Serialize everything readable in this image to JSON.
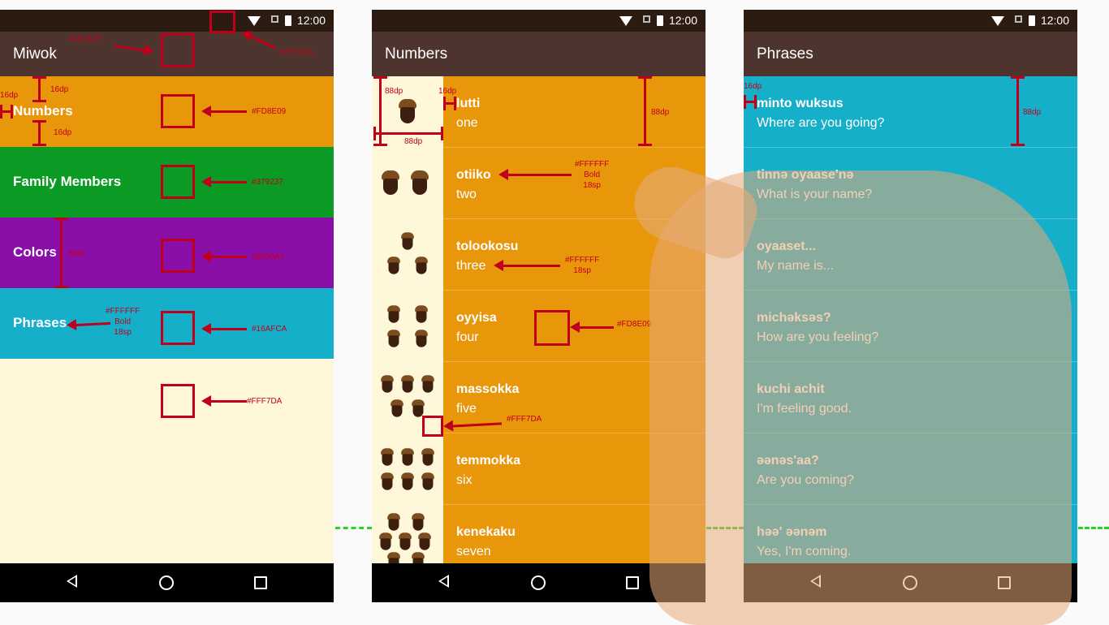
{
  "status_time": "12:00",
  "phone1": {
    "title": "Miwok",
    "categories": [
      {
        "label": "Numbers",
        "color": "#FD8E09"
      },
      {
        "label": "Family Members",
        "color": "#379237"
      },
      {
        "label": "Colors",
        "color": "#8800A0"
      },
      {
        "label": "Phrases",
        "color": "#16AFCA"
      }
    ],
    "background": "#FFF7DA",
    "annotations": {
      "appbar_color": "#4E342E",
      "statusbar_color": "#2F1D1A",
      "numbers_color": "#FD8E09",
      "family_color": "#379237",
      "colors_color": "#8800A0",
      "phrases_color": "#16AFCA",
      "bg_color": "#FFF7DA",
      "dp16_a": "16dp",
      "dp16_b": "16dp",
      "dp16_c": "16dp",
      "dp88": "88dp",
      "text_style": [
        "#FFFFFF",
        "Bold",
        "18sp"
      ]
    }
  },
  "phone2": {
    "title": "Numbers",
    "row_color": "#FD8E09",
    "image_bg": "#FFF7DA",
    "rows": [
      {
        "miwok": "lutti",
        "english": "one",
        "acorns": 1
      },
      {
        "miwok": "otiiko",
        "english": "two",
        "acorns": 2
      },
      {
        "miwok": "tolookosu",
        "english": "three",
        "acorns": 3
      },
      {
        "miwok": "oyyisa",
        "english": "four",
        "acorns": 4
      },
      {
        "miwok": "massokka",
        "english": "five",
        "acorns": 5
      },
      {
        "miwok": "temmokka",
        "english": "six",
        "acorns": 6
      },
      {
        "miwok": "kenekaku",
        "english": "seven",
        "acorns": 7
      }
    ],
    "annotations": {
      "dp88_img_h": "88dp",
      "dp88_img_w": "88dp",
      "dp16": "16dp",
      "dp88_row": "88dp",
      "miwok_style": [
        "#FFFFFF",
        "Bold",
        "18sp"
      ],
      "english_style": [
        "#FFFFFF",
        "18sp"
      ],
      "row_color": "#FD8E09",
      "img_color": "#FFF7DA"
    }
  },
  "phone3": {
    "title": "Phrases",
    "row_color": "#16AFCA",
    "rows": [
      {
        "miwok": "minto wuksus",
        "english": "Where are you going?"
      },
      {
        "miwok": "tinnә oyaase'nә",
        "english": "What is your name?"
      },
      {
        "miwok": "oyaaset...",
        "english": "My name is..."
      },
      {
        "miwok": "michәksәs?",
        "english": "How are you feeling?"
      },
      {
        "miwok": "kuchi achit",
        "english": "I'm feeling good."
      },
      {
        "miwok": "әәnәs'aa?",
        "english": "Are you coming?"
      },
      {
        "miwok": "hәә' әәnәm",
        "english": "Yes, I'm coming."
      }
    ],
    "annotations": {
      "dp16": "16dp",
      "dp88": "88dp"
    }
  },
  "icons": {
    "wifi": "wifi-icon",
    "signal": "no-signal-icon",
    "battery": "battery-icon",
    "back": "back-icon",
    "home": "home-icon",
    "recents": "recents-icon",
    "acorn": "acorn-icon"
  }
}
